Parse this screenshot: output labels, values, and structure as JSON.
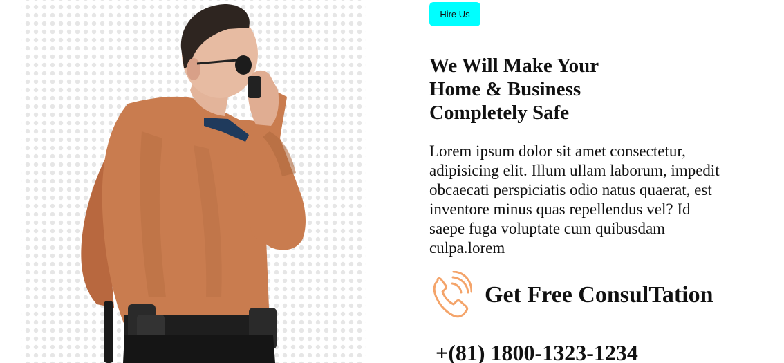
{
  "hero": {
    "hire_button_label": "Hire Us",
    "headline": "We Will Make Your Home & Business Completely Safe",
    "description": "Lorem ipsum dolor sit amet consectetur, adipisicing elit. Illum ullam laborum, impedit obcaecati perspiciatis odio natus quaerat, est inventore minus quas repellendus vel? Id saepe fuga voluptate cum quibusdam culpa.lorem",
    "consultation_label": "Get Free ConsulTation",
    "phone_number": "+(81) 1800-1323-1234",
    "image_alt": "security-guard-photo",
    "icon": "phone-call-icon"
  },
  "colors": {
    "accent_button": "#00ffff",
    "icon_color": "#f4a46a",
    "shirt": "#c97c4f",
    "text": "#111111"
  }
}
